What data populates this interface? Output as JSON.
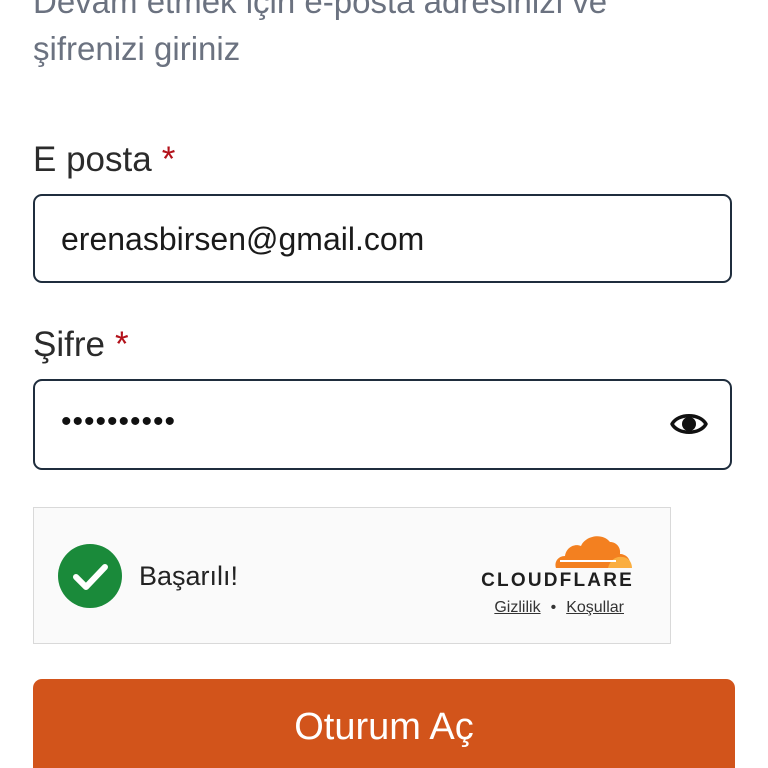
{
  "intro": {
    "subtitle": "Devam etmek için e-posta adresinizi ve\nşifrenizi giriniz"
  },
  "email": {
    "label": "E posta",
    "required_mark": "*",
    "value": "erenasbirsen@gmail.com"
  },
  "password": {
    "label": "Şifre",
    "required_mark": "*",
    "masked_value": "••••••••••",
    "toggle_icon": "eye-icon"
  },
  "captcha": {
    "status": "Başarılı!",
    "status_icon": "check-circle-icon",
    "provider": "CLOUDFLARE",
    "privacy_link": "Gizlilik",
    "separator": "•",
    "terms_link": "Koşullar"
  },
  "submit": {
    "label": "Oturum Aç"
  },
  "colors": {
    "accent": "#d2541b",
    "success": "#1a8a3a",
    "required": "#b3121b",
    "cloudflare_orange": "#f38020"
  }
}
